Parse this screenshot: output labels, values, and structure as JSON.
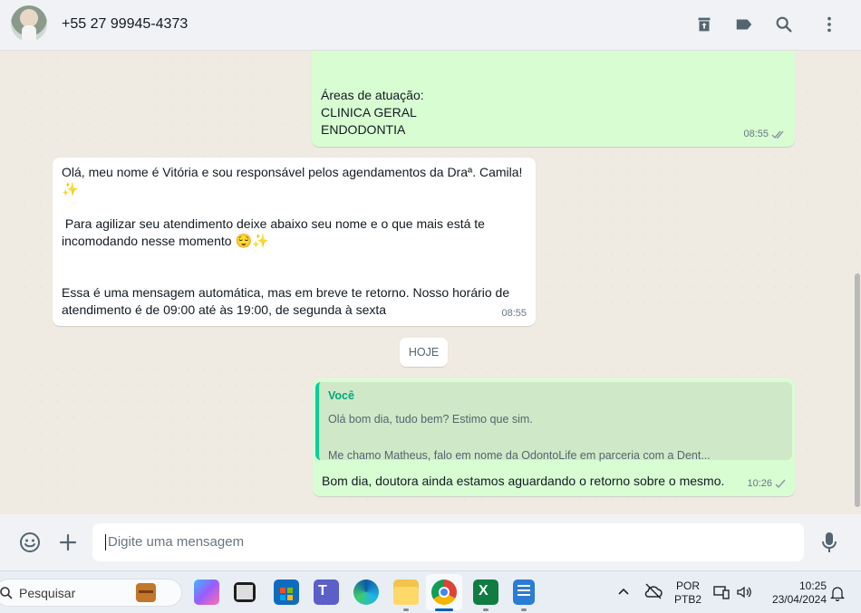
{
  "header": {
    "contact_name": "+55 27 99945-4373",
    "icons": [
      "archive-icon",
      "label-icon",
      "search-icon",
      "menu-icon"
    ]
  },
  "messages": [
    {
      "direction": "outgoing",
      "lines": [
        "Áreas de atuação:",
        "CLINICA GERAL",
        "ENDODONTIA"
      ],
      "time": "08:55",
      "status": "double-check"
    },
    {
      "direction": "incoming",
      "p1": "Olá, meu nome é Vitória e sou responsável pelos agendamentos da Draª. Camila!",
      "p1_emoji": "✨",
      "p2": " Para agilizar seu atendimento deixe abaixo seu nome e o que mais está te incomodando nesse momento",
      "p2_emoji": "😌✨",
      "p3": "Essa é uma mensagem automática, mas em breve te retorno. Nosso horário de atendimento é de 09:00 até às 19:00, de segunda à sexta",
      "time": "08:55"
    },
    {
      "direction": "outgoing",
      "quote_author": "Você",
      "quote_line1": "Olá bom dia, tudo bem? Estimo que sim.",
      "quote_line2": "Me chamo Matheus, falo em nome da OdontoLife em parceria com a Dent...",
      "text": "Bom dia, doutora ainda estamos aguardando o retorno sobre o mesmo.",
      "time": "10:26",
      "status": "single-check"
    }
  ],
  "day_divider": "HOJE",
  "composer": {
    "placeholder": "Digite uma mensagem",
    "icons": [
      "emoji-icon",
      "plus-icon",
      "mic-icon"
    ]
  },
  "taskbar": {
    "search_placeholder": "Pesquisar",
    "apps": [
      "briefcase",
      "copilot",
      "terminal",
      "store",
      "teams",
      "edge",
      "file-explorer",
      "chrome",
      "excel",
      "notepad"
    ],
    "language_line1": "POR",
    "language_line2": "PTB2",
    "clock_time": "10:25",
    "clock_date": "23/04/2024"
  },
  "colors": {
    "outgoing_bubble": "#d9fdd3",
    "incoming_bubble": "#ffffff",
    "chat_background": "#efeae2",
    "accent_green": "#06cf9c"
  }
}
